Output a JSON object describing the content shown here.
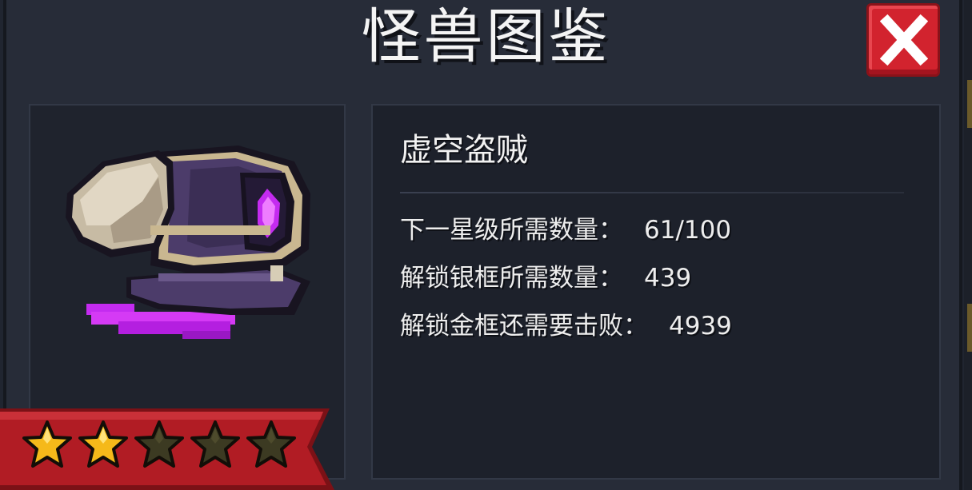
{
  "title": "怪兽图鉴",
  "close_button": {
    "icon": "close-icon"
  },
  "monster": {
    "name": "虚空盗贼",
    "portrait_icon": "void-thief-portrait"
  },
  "stats": [
    {
      "label": "下一星级所需数量：",
      "value": "61/100"
    },
    {
      "label": "解锁银框所需数量：",
      "value": "439"
    },
    {
      "label": "解锁金框还需要击败：",
      "value": "4939"
    }
  ],
  "rating": {
    "stars_filled": 2,
    "stars_total": 5
  },
  "colors": {
    "accent_red": "#d2232e",
    "star_gold": "#f5b91a",
    "star_empty": "#3c3a22",
    "void_purple": "#c42bf0"
  }
}
